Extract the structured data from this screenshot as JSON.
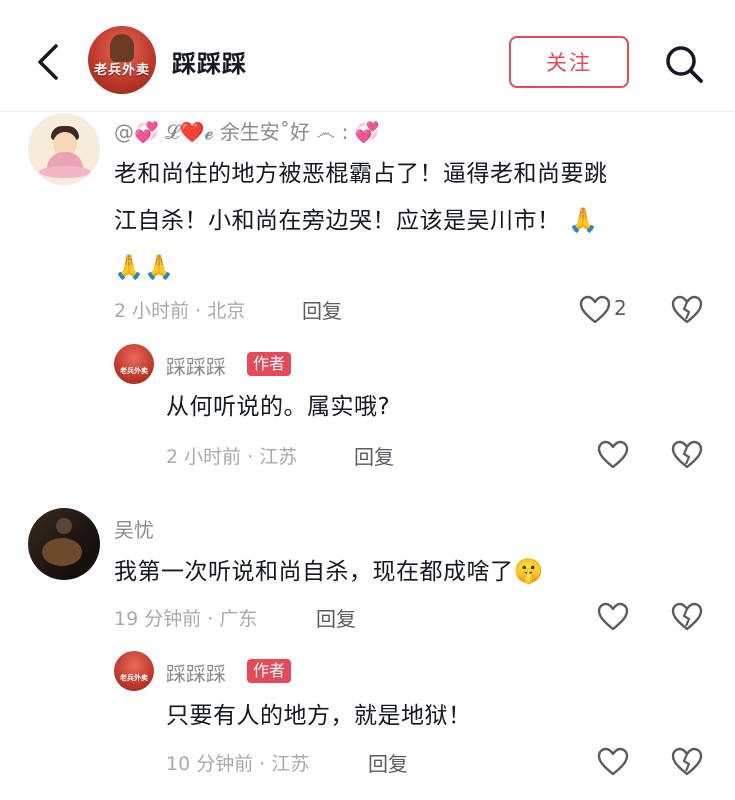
{
  "header": {
    "account_name": "踩踩踩",
    "avatar_logo_text": "老兵外卖",
    "follow_label": "关注"
  },
  "comments": [
    {
      "username": "@💞 𝓛❤️𝓮 余生安˚好 ෴ : 💞",
      "text_line1": "老和尚住的地方被恶棍霸占了！逼得老和尚要跳",
      "text_line2": "江自杀！小和尚在旁边哭！应该是吴川市！",
      "emoji": "🙏",
      "time_location": "2 小时前 · 北京",
      "reply_label": "回复",
      "like_count": "2",
      "reply": {
        "username": "踩踩踩",
        "author_tag": "作者",
        "text": "从何听说的。属实哦?",
        "time_location": "2 小时前 · 江苏",
        "reply_label": "回复"
      }
    },
    {
      "username": "吴忧",
      "text": "我第一次听说和尚自杀，现在都成啥了",
      "emoji": "🤫",
      "time_location": "19 分钟前 · 广东",
      "reply_label": "回复",
      "reply": {
        "username": "踩踩踩",
        "author_tag": "作者",
        "text": "只要有人的地方，就是地狱！",
        "time_location": "10 分钟前 · 江苏",
        "reply_label": "回复"
      }
    }
  ],
  "colors": {
    "accent": "#e54a5a",
    "text_primary": "#161823",
    "text_secondary": "#a8a9ae"
  }
}
